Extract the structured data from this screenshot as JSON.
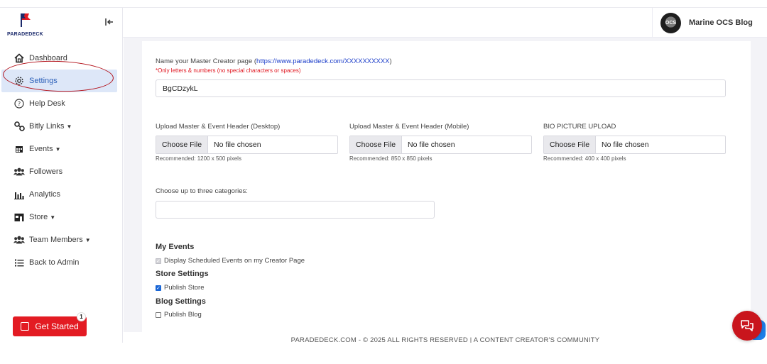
{
  "app": {
    "logo_text": "PARADEDECK"
  },
  "sidebar": {
    "items": [
      {
        "label": "Dashboard",
        "icon": "home-icon",
        "caret": false
      },
      {
        "label": "Settings",
        "icon": "gear-icon",
        "caret": false,
        "active": true
      },
      {
        "label": "Help Desk",
        "icon": "question-circle-icon",
        "caret": false
      },
      {
        "label": "Bitly Links",
        "icon": "link-icon",
        "caret": true
      },
      {
        "label": "Events",
        "icon": "calendar-icon",
        "caret": true
      },
      {
        "label": "Followers",
        "icon": "users-icon",
        "caret": false
      },
      {
        "label": "Analytics",
        "icon": "bar-chart-icon",
        "caret": false
      },
      {
        "label": "Store",
        "icon": "store-icon",
        "caret": true
      },
      {
        "label": "Team Members",
        "icon": "team-icon",
        "caret": true
      },
      {
        "label": "Back to Admin",
        "icon": "list-icon",
        "caret": false
      }
    ],
    "get_started": {
      "label": "Get Started",
      "badge": "1"
    }
  },
  "header": {
    "profile_name": "Marine OCS Blog",
    "avatar_text": "OCS"
  },
  "form": {
    "page_name": {
      "label_prefix": "Name your Master Creator page (",
      "url": "https://www.paradedeck.com/XXXXXXXXXX",
      "label_suffix": ")",
      "hint": "*Only letters & numbers (no special characters or spaces)",
      "value": "BgCDzykL"
    },
    "uploads": [
      {
        "label": "Upload Master & Event Header (Desktop)",
        "button": "Choose File",
        "status": "No file chosen",
        "recommend": "Recommended: 1200 x 500 pixels"
      },
      {
        "label": "Upload Master & Event Header (Mobile)",
        "button": "Choose File",
        "status": "No file chosen",
        "recommend": "Recommended: 850 x 850 pixels"
      },
      {
        "label": "BIO PICTURE UPLOAD",
        "button": "Choose File",
        "status": "No file chosen",
        "recommend": "Recommended: 400 x 400 pixels"
      }
    ],
    "categories": {
      "label": "Choose up to three categories:",
      "value": ""
    },
    "my_events": {
      "title": "My Events",
      "option": "Display Scheduled Events on my Creator Page",
      "checked": true,
      "disabled": true
    },
    "store_settings": {
      "title": "Store Settings",
      "option": "Publish Store",
      "checked": true
    },
    "blog_settings": {
      "title": "Blog Settings",
      "option": "Publish Blog",
      "checked": false
    }
  },
  "footer": {
    "text": "PARADEDECK.COM - © 2025 ALL RIGHTS RESERVED | A CONTENT CREATOR'S COMMUNITY"
  },
  "colors": {
    "brand_red": "#e31b23",
    "active_bg": "#dde7f8",
    "link_blue": "#1a3cc9"
  }
}
